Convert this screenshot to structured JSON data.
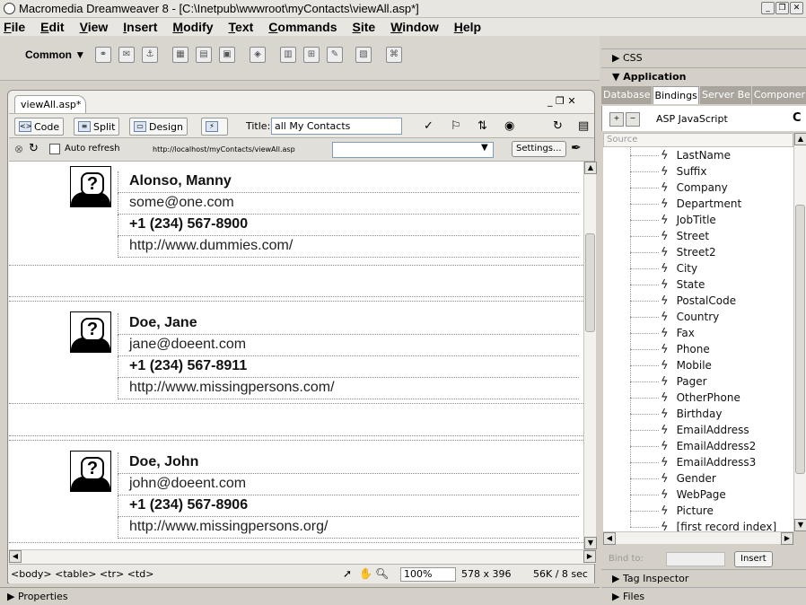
{
  "app": {
    "window_title": "Macromedia Dreamweaver 8 - [C:\\Inetpub\\wwwroot\\myContacts\\viewAll.asp*]"
  },
  "menu": [
    "File",
    "Edit",
    "View",
    "Insert",
    "Modify",
    "Text",
    "Commands",
    "Site",
    "Window",
    "Help"
  ],
  "insert_bar": {
    "category": "Common ▼"
  },
  "document": {
    "tab": "viewAll.asp*",
    "views": {
      "code": "Code",
      "split": "Split",
      "design": "Design"
    },
    "title_label": "Title:",
    "title_value": "all My Contacts",
    "auto_refresh_label": "Auto refresh",
    "url": "http://localhost/myContacts/viewAll.asp",
    "settings_button": "Settings..."
  },
  "contacts": [
    {
      "name": "Alonso, Manny",
      "email": "some@one.com",
      "phone": "+1 (234) 567-8900",
      "url": "http://www.dummies.com/"
    },
    {
      "name": "Doe, Jane",
      "email": "jane@doeent.com",
      "phone": "+1 (234) 567-8911",
      "url": "http://www.missingpersons.com/"
    },
    {
      "name": "Doe, John",
      "email": "john@doeent.com",
      "phone": "+1 (234) 567-8906",
      "url": "http://www.missingpersons.org/"
    }
  ],
  "statusbar": {
    "tag_selector": "<body> <table> <tr> <td>",
    "zoom": "100%",
    "window_size": "578 x 396",
    "download": "56K / 8 sec"
  },
  "properties_panel": {
    "label": "Properties"
  },
  "right_panels": {
    "css": "CSS",
    "application": "Application",
    "tabs": [
      "Database",
      "Bindings",
      "Server Be",
      "Componer"
    ],
    "active_tab": "Bindings",
    "server_model": "ASP JavaScript",
    "list_header": "Source",
    "bindings": [
      "LastName",
      "Suffix",
      "Company",
      "Department",
      "JobTitle",
      "Street",
      "Street2",
      "City",
      "State",
      "PostalCode",
      "Country",
      "Fax",
      "Phone",
      "Mobile",
      "Pager",
      "OtherPhone",
      "Birthday",
      "EmailAddress",
      "EmailAddress2",
      "EmailAddress3",
      "Gender",
      "WebPage",
      "Picture",
      "[first record index]"
    ],
    "bind_to_label": "Bind to:",
    "insert_button": "Insert",
    "tag_inspector": "Tag Inspector",
    "files": "Files"
  }
}
